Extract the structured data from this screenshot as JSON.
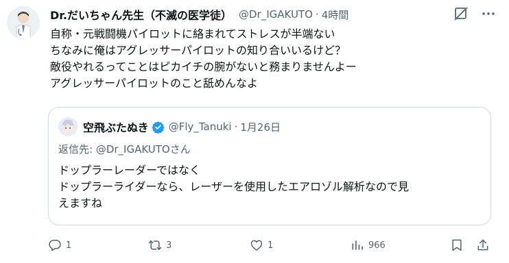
{
  "tweet": {
    "display_name": "Dr.だいちゃん先生（不滅の医学徒）",
    "handle": "@Dr_IGAKUTO",
    "separator": "·",
    "time": "4時間",
    "body_lines": [
      "自称・元戦闘機パイロットに絡まれてストレスが半端ない",
      "ちなみに俺はアグレッサーパイロットの知り合いいるけど？",
      "敵役やれるってことはピカイチの腕がないと務まりませんよー",
      "アグレッサーパイロットのこと舐めんなよ"
    ]
  },
  "quote": {
    "display_name": "空飛ぶたぬき",
    "handle": "@Fly_Tanuki",
    "separator": "·",
    "date": "1月26日",
    "reply_to_prefix": "返信先: ",
    "reply_to_handle": "@Dr_IGAKUTOさん",
    "lines": [
      "ドップラーレーダーではなく",
      "ドップラーライダーなら、レーザーを使用したエアロゾル解析なので見",
      "えますね"
    ]
  },
  "actions": {
    "reply_count": "1",
    "retweet_count": "3",
    "like_count": "1",
    "view_count": "966"
  },
  "icons": {
    "reply": "reply-icon",
    "retweet": "retweet-icon",
    "like": "heart-icon",
    "views": "views-icon",
    "bookmark": "bookmark-icon",
    "share": "share-icon",
    "grok": "grok-icon",
    "more": "more-icon",
    "verified": "verified-badge-icon"
  },
  "colors": {
    "text": "#0f1419",
    "secondary": "#536471",
    "border": "#cfd9de",
    "verified": "#1d9bf0"
  }
}
